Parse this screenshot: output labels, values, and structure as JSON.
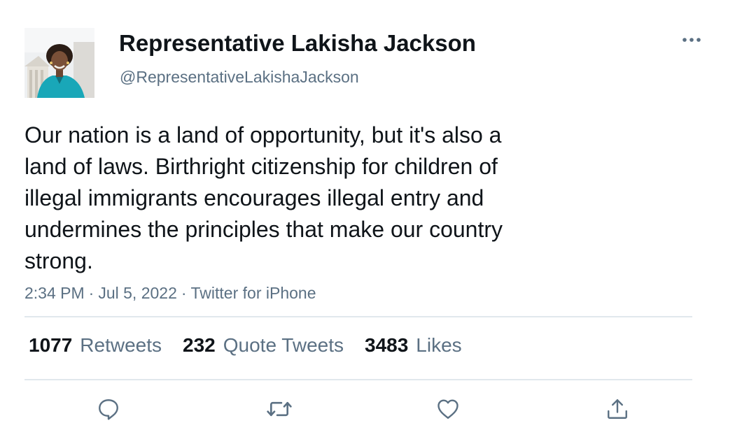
{
  "author": {
    "display_name": "Representative Lakisha Jackson",
    "handle": "@RepresentativeLakishaJackson",
    "avatar_icon": "profile-photo"
  },
  "tweet": {
    "text": "Our nation is a land of opportunity, but it's also a\nland of laws. Birthright citizenship for children of\nillegal immigrants encourages illegal entry and\nundermines the principles that make our country\nstrong.",
    "time": "2:34 PM",
    "separator": "·",
    "date": "Jul 5, 2022",
    "source": "Twitter for iPhone"
  },
  "stats": {
    "retweets": {
      "count": "1077",
      "label": "Retweets"
    },
    "quotes": {
      "count": "232",
      "label": "Quote Tweets"
    },
    "likes": {
      "count": "3483",
      "label": "Likes"
    }
  },
  "actions": [
    {
      "icon": "reply-icon"
    },
    {
      "icon": "retweet-icon"
    },
    {
      "icon": "like-icon"
    },
    {
      "icon": "share-icon"
    }
  ],
  "colors": {
    "text_primary": "#0f1419",
    "text_secondary": "#5b7083",
    "divider": "#e1e8ed"
  }
}
